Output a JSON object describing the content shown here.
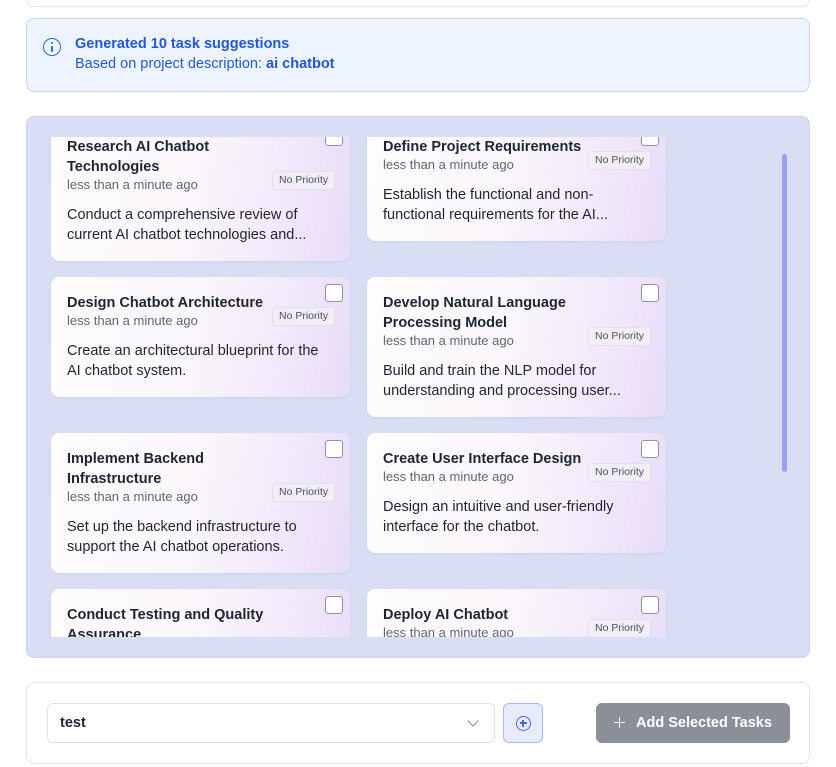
{
  "banner": {
    "title": "Generated 10 task suggestions",
    "subtitle_prefix": "Based on project description:",
    "subtitle_value": "ai chatbot",
    "icon": "info-icon"
  },
  "tasks": [
    {
      "title": "Research AI Chatbot Technologies",
      "time": "less than a minute ago",
      "priority": "No Priority",
      "description": "Conduct a comprehensive review of current AI chatbot technologies and..."
    },
    {
      "title": "Define Project Requirements",
      "time": "less than a minute ago",
      "priority": "No Priority",
      "description": "Establish the functional and non-functional requirements for the AI..."
    },
    {
      "title": "Design Chatbot Architecture",
      "time": "less than a minute ago",
      "priority": "No Priority",
      "description": "Create an architectural blueprint for the AI chatbot system."
    },
    {
      "title": "Develop Natural Language Processing Model",
      "time": "less than a minute ago",
      "priority": "No Priority",
      "description": "Build and train the NLP model for understanding and processing user..."
    },
    {
      "title": "Implement Backend Infrastructure",
      "time": "less than a minute ago",
      "priority": "No Priority",
      "description": "Set up the backend infrastructure to support the AI chatbot operations."
    },
    {
      "title": "Create User Interface Design",
      "time": "less than a minute ago",
      "priority": "No Priority",
      "description": "Design an intuitive and user-friendly interface for the chatbot."
    },
    {
      "title": "Conduct Testing and Quality Assurance",
      "time": "",
      "priority": "",
      "description": ""
    },
    {
      "title": "Deploy AI Chatbot",
      "time": "less than a minute ago",
      "priority": "No Priority",
      "description": ""
    }
  ],
  "footer": {
    "project_select_value": "test",
    "add_button_label": "Add Selected Tasks"
  }
}
